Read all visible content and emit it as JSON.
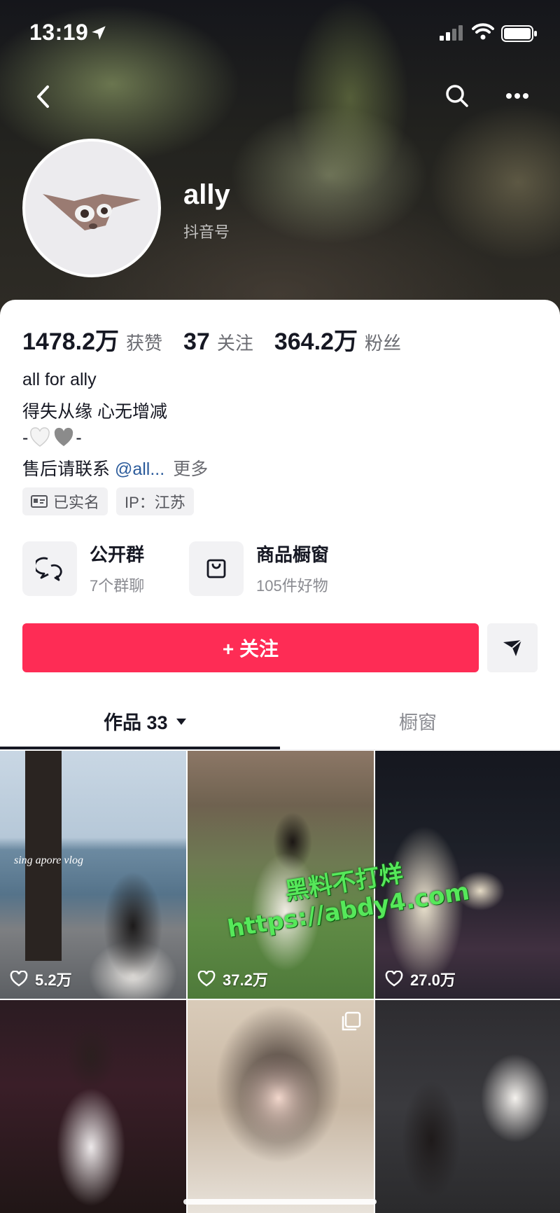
{
  "status_bar": {
    "time": "13:19"
  },
  "profile": {
    "username": "ally",
    "douyin_id_label": "抖音号"
  },
  "stats": {
    "likes_value": "1478.2万",
    "likes_label": "获赞",
    "following_value": "37",
    "following_label": "关注",
    "followers_value": "364.2万",
    "followers_label": "粉丝"
  },
  "bio": {
    "line1": "all for ally",
    "line2": "得失从缘 心无增减",
    "line3_prefix": "-",
    "line3_suffix": "-",
    "line4_text": "售后请联系 ",
    "line4_mention": "@all...",
    "more": "更多"
  },
  "tags": {
    "verified": "已实名",
    "ip": "IP：江苏"
  },
  "features": {
    "group_title": "公开群",
    "group_sub": "7个群聊",
    "shop_title": "商品橱窗",
    "shop_sub": "105件好物"
  },
  "follow_button": "+ 关注",
  "tabs": {
    "works": "作品 33",
    "window": "橱窗"
  },
  "videos": [
    {
      "likes": "5.2万"
    },
    {
      "likes": "37.2万"
    },
    {
      "likes": "27.0万"
    }
  ],
  "video_overlay_text": "sing apore vlog",
  "watermark": {
    "line1": "黑料不打烊",
    "line2": "https://abdy4.com"
  },
  "colors": {
    "follow_button": "#fe2c55",
    "mention": "#2b5b9b",
    "watermark": "#56e85a"
  }
}
